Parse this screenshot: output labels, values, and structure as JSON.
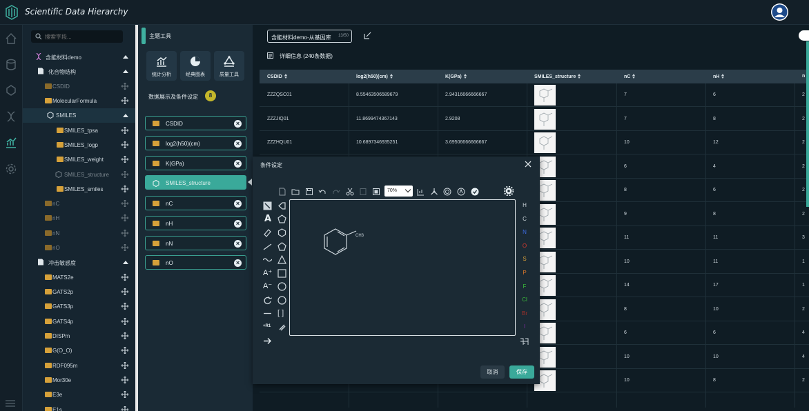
{
  "app": {
    "title": "Scientific Data Hierarchy"
  },
  "sidebar": {
    "search_placeholder": "搜索字段...",
    "items": [
      {
        "label": "含能材料demo",
        "level": 0
      },
      {
        "label": "化合物结构",
        "level": 1
      },
      {
        "label": "CSDID",
        "level": 2
      },
      {
        "label": "MolecularFormula",
        "level": 2
      },
      {
        "label": "SMILES",
        "level": 2
      },
      {
        "label": "SMILES_tpsa",
        "level": 3
      },
      {
        "label": "SMILES_logp",
        "level": 3
      },
      {
        "label": "SMILES_weight",
        "level": 3
      },
      {
        "label": "SMILES_structure",
        "level": 3
      },
      {
        "label": "SMILES_smiles",
        "level": 3
      },
      {
        "label": "nC",
        "level": 2
      },
      {
        "label": "nH",
        "level": 2
      },
      {
        "label": "nN",
        "level": 2
      },
      {
        "label": "nO",
        "level": 2
      },
      {
        "label": "冲击敏感度",
        "level": 1
      },
      {
        "label": "MATS2e",
        "level": 2
      },
      {
        "label": "GATS2p",
        "level": 2
      },
      {
        "label": "GATS3p",
        "level": 2
      },
      {
        "label": "GATS4p",
        "level": 2
      },
      {
        "label": "DISPm",
        "level": 2
      },
      {
        "label": "G(O_O)",
        "level": 2
      },
      {
        "label": "RDF095m",
        "level": 2
      },
      {
        "label": "Mor30e",
        "level": 2
      },
      {
        "label": "E3e",
        "level": 2
      },
      {
        "label": "E1s",
        "level": 2
      }
    ]
  },
  "tools": {
    "title": "主题工具",
    "cards": [
      "统计分析",
      "经典图表",
      "质量工具"
    ],
    "conditions_title": "数据展示及条件设定",
    "conditions_count": "8",
    "fields": [
      "CSDID",
      "log2(h50)(cm)",
      "K(GPa)",
      "SMILES_structure",
      "nC",
      "nH",
      "nN",
      "nO"
    ]
  },
  "dataset": {
    "name": "含能材料demo-从基因库",
    "count": "13/50",
    "detail_title": "详细信息 (240条数据)"
  },
  "table": {
    "columns": [
      "CSDID",
      "log2(h50)(cm)",
      "K(GPa)",
      "SMILES_structure",
      "nC",
      "nH",
      "n"
    ],
    "rows": [
      {
        "csdid": "ZZZQSC01",
        "log": "8.55463506589679",
        "k": "2.94316666666667",
        "nc": "7",
        "nh": "6",
        "n": "2"
      },
      {
        "csdid": "ZZZJIQ01",
        "log": "11.8699474367143",
        "k": "2.9208",
        "nc": "7",
        "nh": "8",
        "n": "2"
      },
      {
        "csdid": "ZZZHQU01",
        "log": "10.6897346935251",
        "k": "3.69506666666667",
        "nc": "10",
        "nh": "12",
        "n": "2"
      },
      {
        "csdid": "",
        "log": "",
        "k": "",
        "nc": "6",
        "nh": "4",
        "n": "2"
      },
      {
        "csdid": "",
        "log": "",
        "k": "",
        "nc": "8",
        "nh": "6",
        "n": "2"
      },
      {
        "csdid": "",
        "log": "",
        "k": "",
        "nc": "9",
        "nh": "8",
        "n": "2"
      },
      {
        "csdid": "",
        "log": "",
        "k": "",
        "nc": "11",
        "nh": "11",
        "n": "3"
      },
      {
        "csdid": "",
        "log": "",
        "k": "",
        "nc": "10",
        "nh": "11",
        "n": "1"
      },
      {
        "csdid": "",
        "log": "",
        "k": "",
        "nc": "14",
        "nh": "17",
        "n": "1"
      },
      {
        "csdid": "",
        "log": "",
        "k": "",
        "nc": "8",
        "nh": "10",
        "n": "2"
      },
      {
        "csdid": "",
        "log": "",
        "k": "",
        "nc": "6",
        "nh": "6",
        "n": "4"
      },
      {
        "csdid": "",
        "log": "",
        "k": "",
        "nc": "10",
        "nh": "10",
        "n": "4"
      },
      {
        "csdid": "",
        "log": "",
        "k": "",
        "nc": "10",
        "nh": "8",
        "n": "2"
      }
    ]
  },
  "modal": {
    "title": "条件设定",
    "zoom": "70%",
    "molecule_label": "CH3",
    "elements": [
      {
        "symbol": "H",
        "color": "#cdd6dc"
      },
      {
        "symbol": "C",
        "color": "#cdd6dc"
      },
      {
        "symbol": "N",
        "color": "#3f6ee8"
      },
      {
        "symbol": "O",
        "color": "#e03a2e"
      },
      {
        "symbol": "S",
        "color": "#e0a33a"
      },
      {
        "symbol": "P",
        "color": "#e07a2a"
      },
      {
        "symbol": "F",
        "color": "#3bbf3b"
      },
      {
        "symbol": "Cl",
        "color": "#3bbf3b"
      },
      {
        "symbol": "Br",
        "color": "#a0302a"
      },
      {
        "symbol": "I",
        "color": "#7a2a9a"
      }
    ],
    "cancel_label": "取消",
    "save_label": "保存"
  }
}
